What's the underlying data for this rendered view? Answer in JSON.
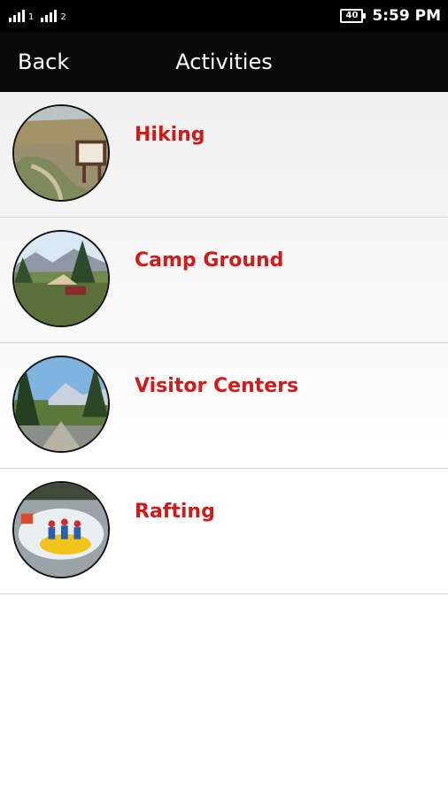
{
  "status_bar": {
    "sim1": "1",
    "sim2": "2",
    "battery": "40",
    "time": "5:59 PM"
  },
  "nav": {
    "back_label": "Back",
    "title": "Activities"
  },
  "activities": [
    {
      "label": "Hiking",
      "image": "hiking-photo"
    },
    {
      "label": "Camp Ground",
      "image": "campground-photo"
    },
    {
      "label": "Visitor Centers",
      "image": "visitor-center-photo"
    },
    {
      "label": "Rafting",
      "image": "rafting-photo"
    }
  ],
  "colors": {
    "label": "#d11a1a",
    "nav_bg": "#0a0a0a"
  }
}
